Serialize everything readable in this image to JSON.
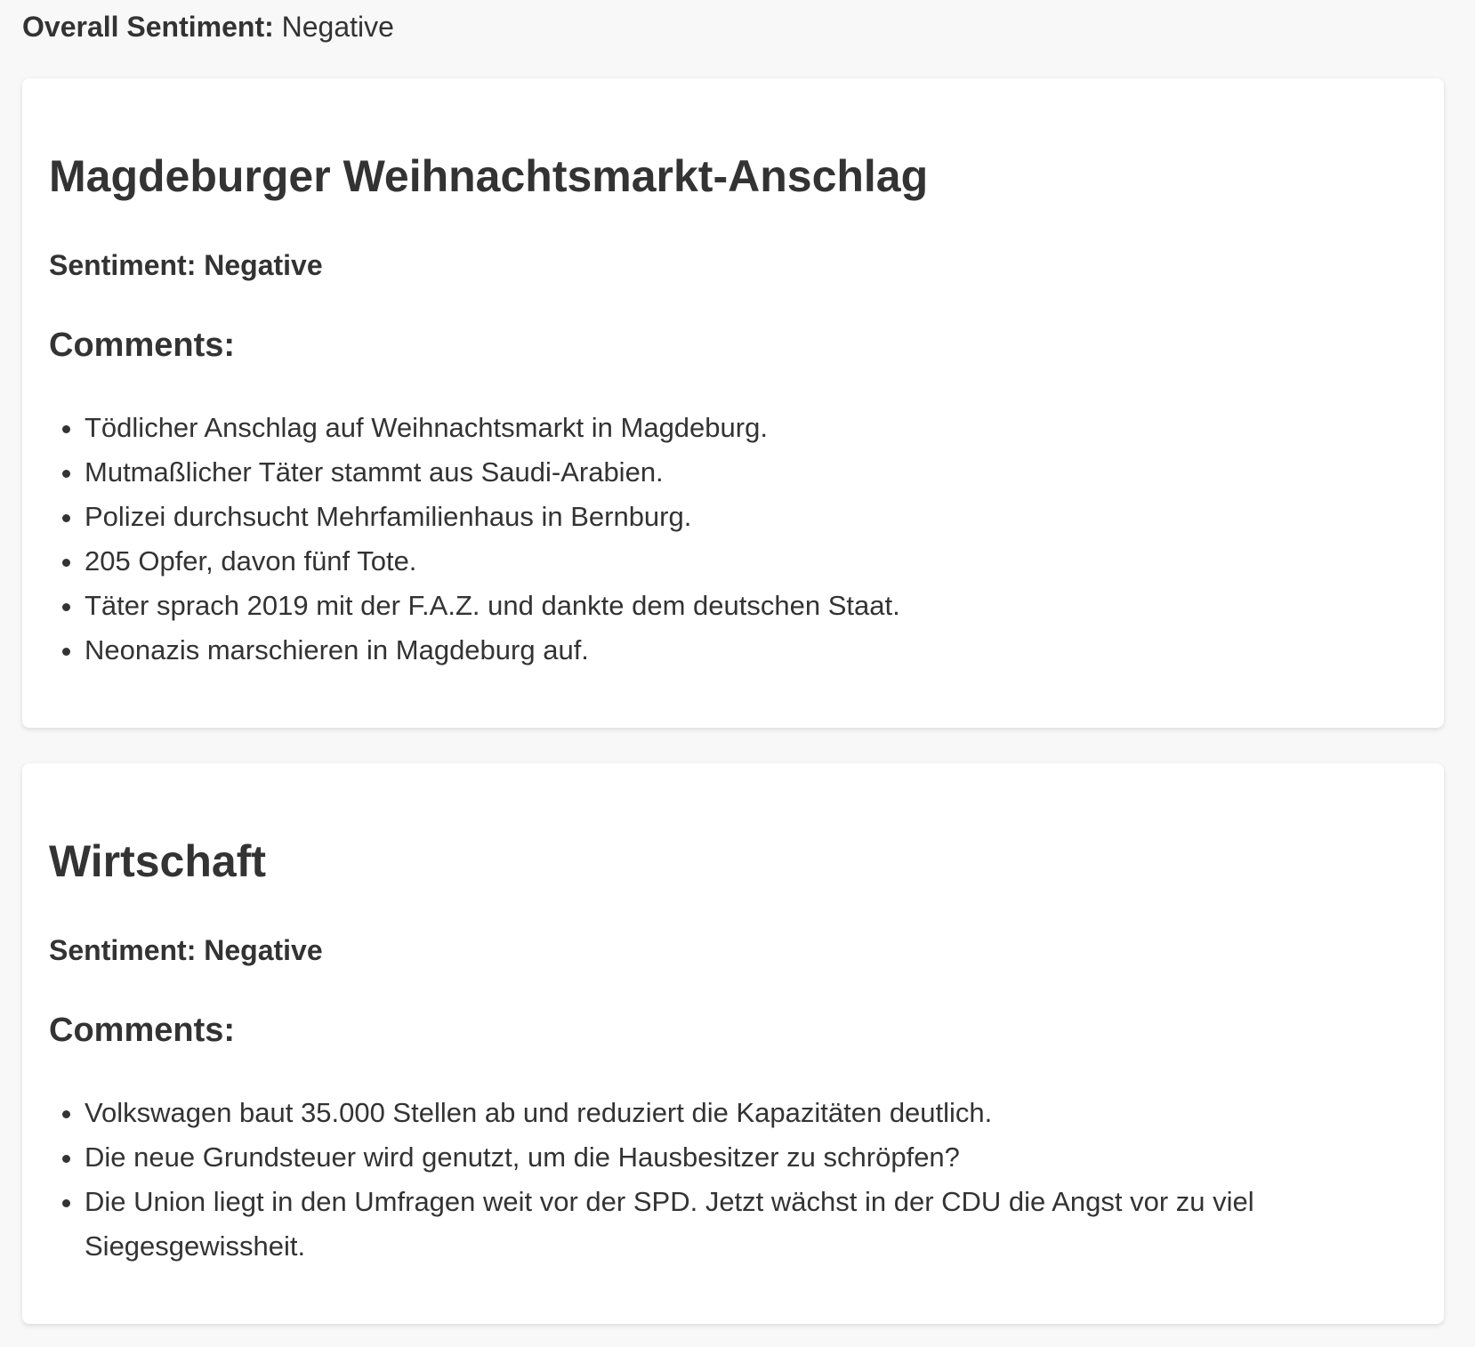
{
  "overall": {
    "label": "Overall Sentiment:",
    "value": "Negative"
  },
  "cards": [
    {
      "title": "Magdeburger Weihnachtsmarkt-Anschlag",
      "sentiment": "Sentiment: Negative",
      "comments_heading": "Comments:",
      "comments": [
        "Tödlicher Anschlag auf Weihnachtsmarkt in Magdeburg.",
        "Mutmaßlicher Täter stammt aus Saudi-Arabien.",
        "Polizei durchsucht Mehrfamilienhaus in Bernburg.",
        "205 Opfer, davon fünf Tote.",
        "Täter sprach 2019 mit der F.A.Z. und dankte dem deutschen Staat.",
        "Neonazis marschieren in Magdeburg auf."
      ]
    },
    {
      "title": "Wirtschaft",
      "sentiment": "Sentiment: Negative",
      "comments_heading": "Comments:",
      "comments": [
        "Volkswagen baut 35.000 Stellen ab und reduziert die Kapazitäten deutlich.",
        "Die neue Grundsteuer wird genutzt, um die Hausbesitzer zu schröpfen?",
        "Die Union liegt in den Umfragen weit vor der SPD. Jetzt wächst in der CDU die Angst vor zu viel Siegesgewissheit."
      ]
    }
  ]
}
